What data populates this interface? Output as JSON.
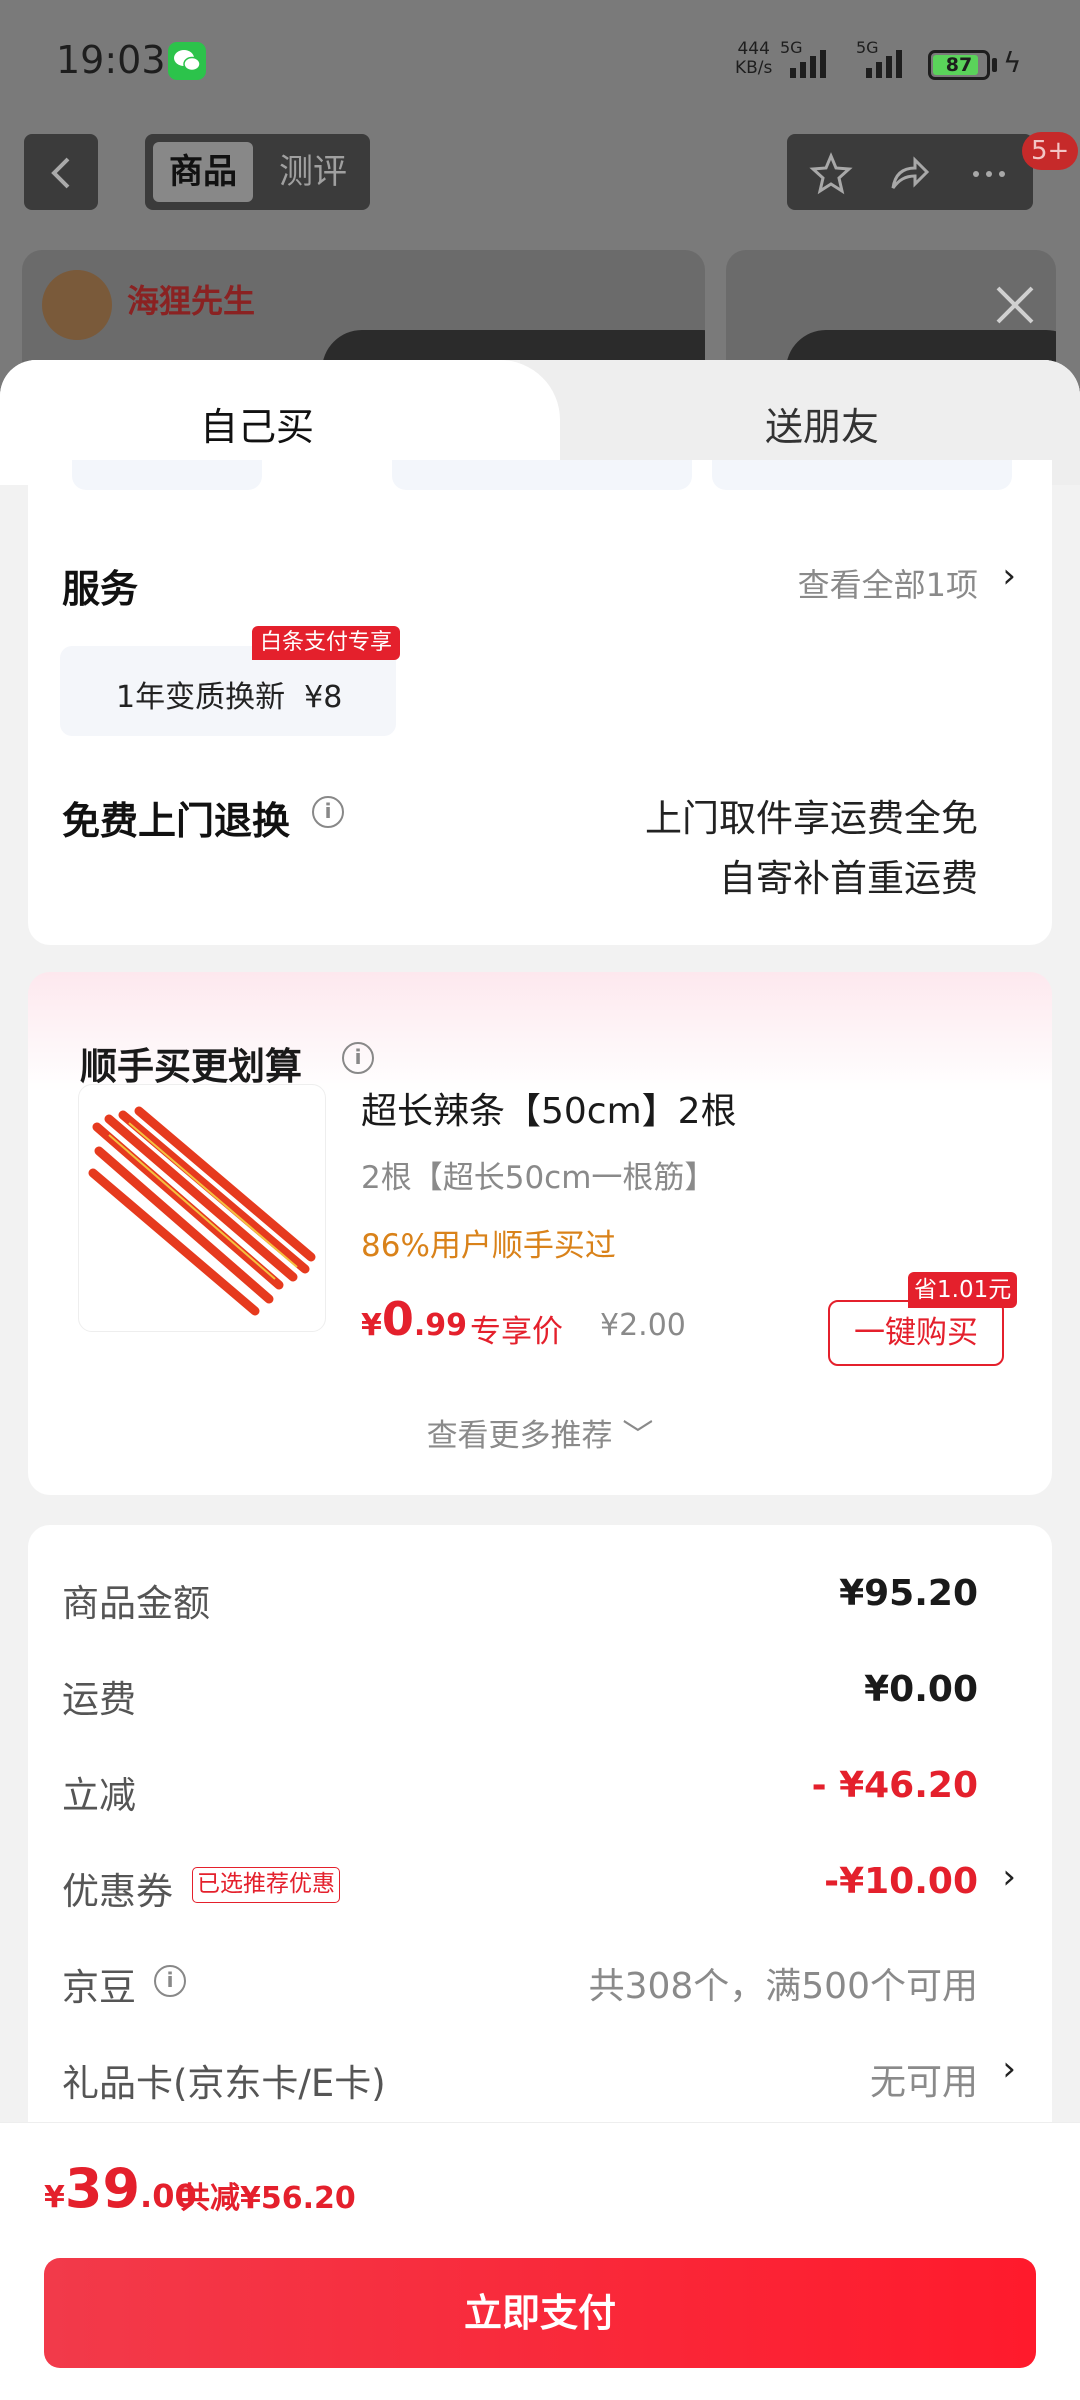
{
  "status_bar": {
    "time": "19:03",
    "net_speed_value": "444",
    "net_speed_unit": "KB/s",
    "signal_1": "5G",
    "signal_2": "5G",
    "battery": "87",
    "battery_level": 0.87
  },
  "top_nav": {
    "tab_product": "商品",
    "tab_review": "测评",
    "message_badge": "5+",
    "icons": [
      "back-icon",
      "star-icon",
      "share-icon",
      "more-icon",
      "close-icon"
    ]
  },
  "banner": {
    "brand": "海狸先生"
  },
  "sheet_tabs": {
    "self_buy": "自己买",
    "gift": "送朋友"
  },
  "service": {
    "title": "服务",
    "view_all": "查看全部1项",
    "option_tag": "白条支付专享",
    "option_label": "1年变质换新",
    "option_price": "¥8",
    "return_title": "免费上门退换",
    "return_line1": "上门取件享运费全免",
    "return_line2": "自寄补首重运费"
  },
  "bundle": {
    "title": "顺手买更划算",
    "product_name": "超长辣条【50cm】2根",
    "product_spec": "2根【超长50cm一根筋】",
    "bought_ratio": "86%用户顺手买过",
    "price_symbol": "¥",
    "price_int": "0",
    "price_dec": ".99",
    "exclusive_label": "专享价",
    "original_price": "¥2.00",
    "save_tag": "省1.01元",
    "buy_button": "一键购买",
    "more": "查看更多推荐 ﹀"
  },
  "price_detail": {
    "goods_amount_label": "商品金额",
    "goods_amount": "¥95.20",
    "shipping_label": "运费",
    "shipping": "¥0.00",
    "discount_label": "立减",
    "discount": "- ¥46.20",
    "coupon_label": "优惠券",
    "coupon_tag": "已选推荐优惠",
    "coupon": "-¥10.00",
    "bean_label": "京豆",
    "bean_value": "共308个，满500个可用",
    "giftcard_label": "礼品卡(京东卡/E卡)",
    "giftcard_value": "无可用"
  },
  "footer": {
    "total_symbol": "¥",
    "total_int": "39",
    "total_dec": ".00",
    "total_saved": "共减¥56.20",
    "pay_button": "立即支付"
  },
  "colors": {
    "accent_red": "#e4202c",
    "bought_orange": "#d9821a",
    "battery_green": "#5ad35a"
  }
}
